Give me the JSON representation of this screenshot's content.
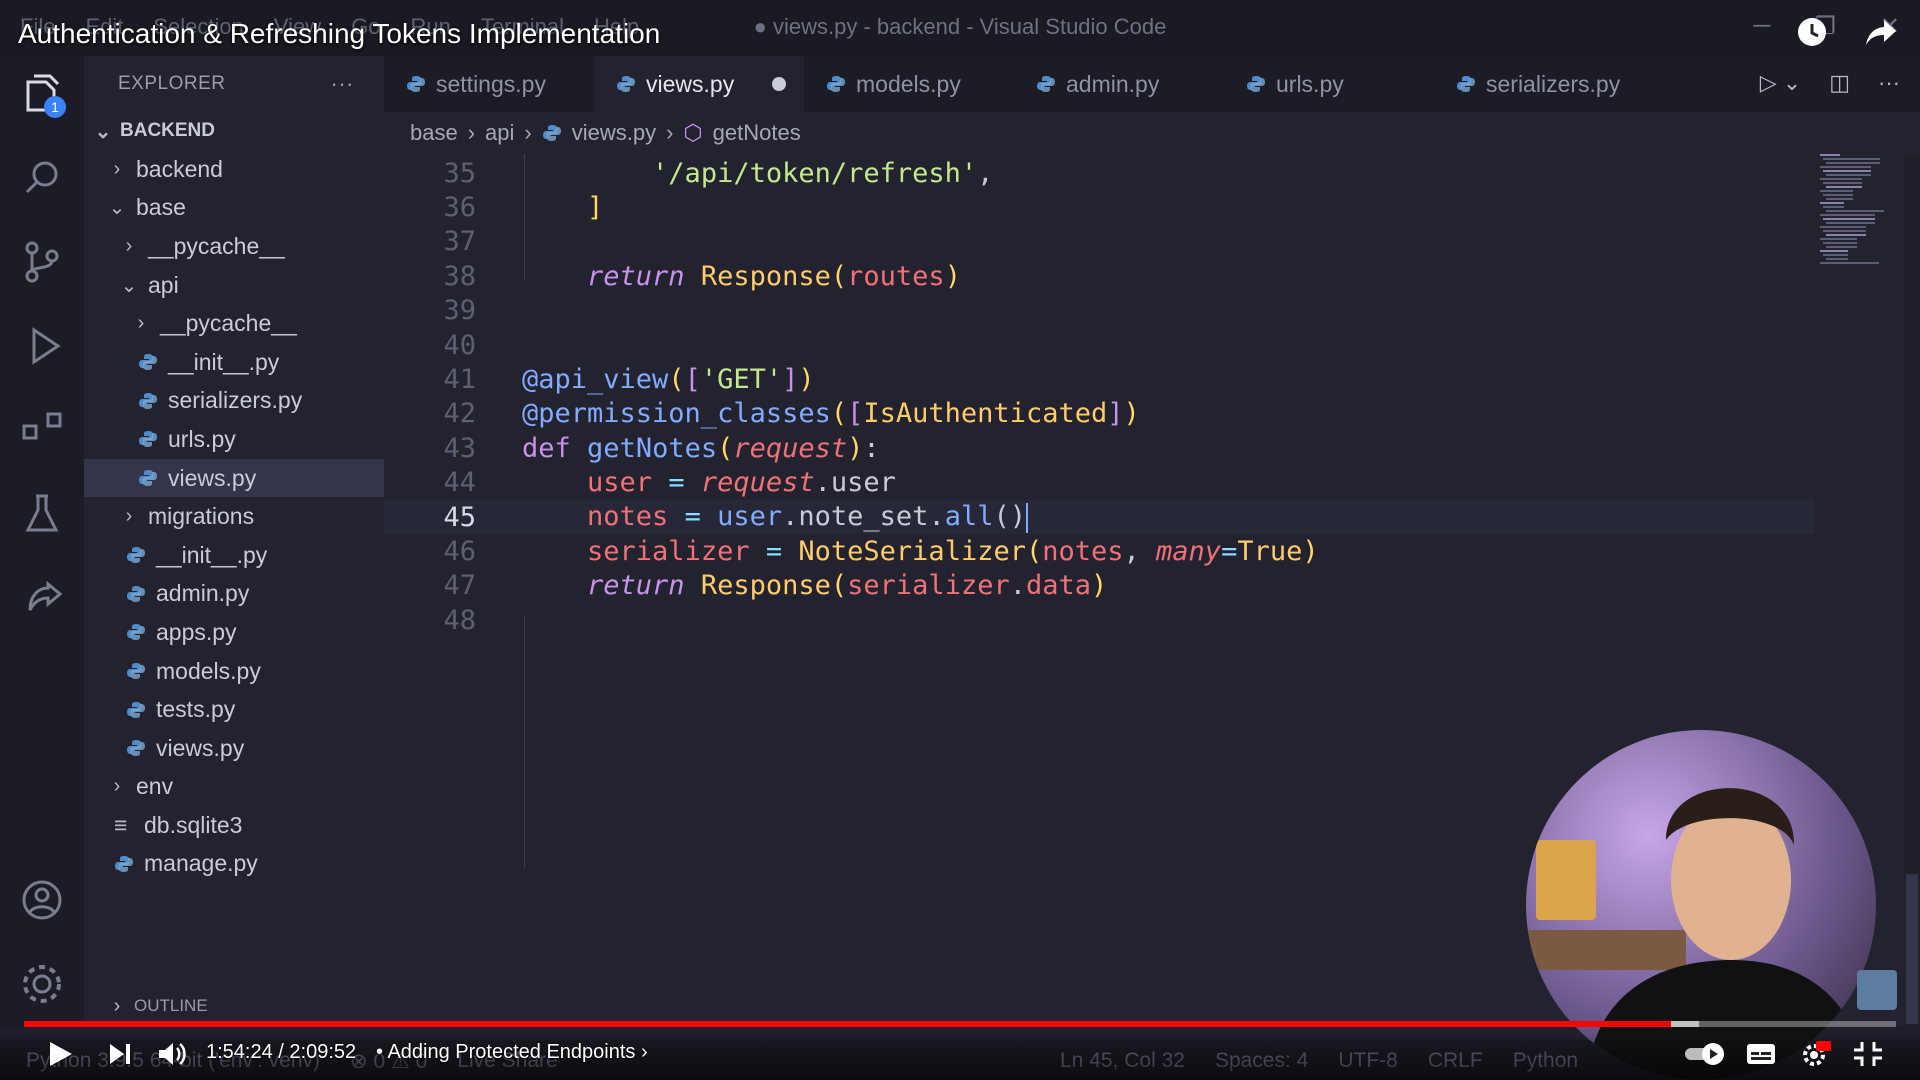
{
  "video": {
    "title": "Authentication & Refreshing Tokens Implementation",
    "time": "1:54:24 / 2:09:52",
    "chapter": "Adding Protected Endpoints",
    "chapter_sep": "•",
    "progress_fraction": 0.88
  },
  "window": {
    "menu": [
      "File",
      "Edit",
      "Selection",
      "View",
      "Go",
      "Run",
      "Terminal",
      "Help"
    ],
    "title": "● views.py - backend - Visual Studio Code"
  },
  "activity": {
    "explorer_badge": "1"
  },
  "sidebar": {
    "header": "EXPLORER",
    "more": "···",
    "root": "BACKEND",
    "items": [
      {
        "label": "backend",
        "type": "folder",
        "open": false,
        "depth": 1
      },
      {
        "label": "base",
        "type": "folder",
        "open": true,
        "depth": 1
      },
      {
        "label": "__pycache__",
        "type": "folder",
        "open": false,
        "depth": 2
      },
      {
        "label": "api",
        "type": "folder",
        "open": true,
        "depth": 2
      },
      {
        "label": "__pycache__",
        "type": "folder",
        "open": false,
        "depth": 3
      },
      {
        "label": "__init__.py",
        "type": "py",
        "depth": 3
      },
      {
        "label": "serializers.py",
        "type": "py",
        "depth": 3
      },
      {
        "label": "urls.py",
        "type": "py",
        "depth": 3
      },
      {
        "label": "views.py",
        "type": "py",
        "depth": 3,
        "selected": true
      },
      {
        "label": "migrations",
        "type": "folder",
        "open": false,
        "depth": 2
      },
      {
        "label": "__init__.py",
        "type": "py",
        "depth": 2
      },
      {
        "label": "admin.py",
        "type": "py",
        "depth": 2
      },
      {
        "label": "apps.py",
        "type": "py",
        "depth": 2
      },
      {
        "label": "models.py",
        "type": "py",
        "depth": 2
      },
      {
        "label": "tests.py",
        "type": "py",
        "depth": 2
      },
      {
        "label": "views.py",
        "type": "py",
        "depth": 2
      },
      {
        "label": "env",
        "type": "folder",
        "open": false,
        "depth": 1
      },
      {
        "label": "db.sqlite3",
        "type": "db",
        "depth": 1
      },
      {
        "label": "manage.py",
        "type": "py",
        "depth": 1
      }
    ],
    "outline": "OUTLINE"
  },
  "tabs": [
    {
      "label": "settings.py",
      "active": false
    },
    {
      "label": "views.py",
      "active": true,
      "modified": true
    },
    {
      "label": "models.py",
      "active": false
    },
    {
      "label": "admin.py",
      "active": false
    },
    {
      "label": "urls.py",
      "active": false
    },
    {
      "label": "serializers.py",
      "active": false
    }
  ],
  "breadcrumb": [
    "base",
    "api",
    "views.py",
    "getNotes"
  ],
  "editor": {
    "current_line": "45",
    "lines": [
      {
        "n": "35",
        "tokens": [
          [
            "pl",
            "        "
          ],
          [
            "s",
            "'/api/token/refresh'"
          ],
          [
            "pl",
            ","
          ]
        ]
      },
      {
        "n": "36",
        "tokens": [
          [
            "pl",
            "    "
          ],
          [
            "br",
            "]"
          ]
        ]
      },
      {
        "n": "37",
        "tokens": []
      },
      {
        "n": "38",
        "tokens": [
          [
            "pl",
            "    "
          ],
          [
            "k it",
            "return"
          ],
          [
            "pl",
            " "
          ],
          [
            "cls",
            "Response"
          ],
          [
            "br",
            "("
          ],
          [
            "v",
            "routes"
          ],
          [
            "br",
            ")"
          ]
        ]
      },
      {
        "n": "39",
        "tokens": []
      },
      {
        "n": "40",
        "tokens": []
      },
      {
        "n": "41",
        "tokens": [
          [
            "fn",
            "@api_view"
          ],
          [
            "br",
            "("
          ],
          [
            "k",
            "["
          ],
          [
            "s",
            "'GET'"
          ],
          [
            "k",
            "]"
          ],
          [
            "br",
            ")"
          ]
        ]
      },
      {
        "n": "42",
        "tokens": [
          [
            "fn",
            "@permission_classes"
          ],
          [
            "br",
            "("
          ],
          [
            "k",
            "["
          ],
          [
            "cls",
            "IsAuthenticated"
          ],
          [
            "k",
            "]"
          ],
          [
            "br",
            ")"
          ]
        ]
      },
      {
        "n": "43",
        "tokens": [
          [
            "k",
            "def"
          ],
          [
            "pl",
            " "
          ],
          [
            "fn",
            "getNotes"
          ],
          [
            "br",
            "("
          ],
          [
            "v it",
            "request"
          ],
          [
            "br",
            ")"
          ],
          [
            "pl",
            ":"
          ]
        ]
      },
      {
        "n": "44",
        "tokens": [
          [
            "pl",
            "    "
          ],
          [
            "v",
            "user"
          ],
          [
            "pl",
            " "
          ],
          [
            "op",
            "="
          ],
          [
            "pl",
            " "
          ],
          [
            "v it",
            "request"
          ],
          [
            "pl",
            ".user"
          ]
        ]
      },
      {
        "n": "45",
        "tokens": [
          [
            "pl",
            "    "
          ],
          [
            "v",
            "notes"
          ],
          [
            "pl",
            " "
          ],
          [
            "op",
            "="
          ],
          [
            "pl",
            " "
          ],
          [
            "fn",
            "user"
          ],
          [
            "pl",
            ".note_set."
          ],
          [
            "fn",
            "all"
          ],
          [
            "pl",
            "()"
          ]
        ]
      },
      {
        "n": "46",
        "tokens": [
          [
            "pl",
            "    "
          ],
          [
            "v",
            "serializer"
          ],
          [
            "pl",
            " "
          ],
          [
            "op",
            "="
          ],
          [
            "pl",
            " "
          ],
          [
            "cls",
            "NoteSerializer"
          ],
          [
            "br",
            "("
          ],
          [
            "v",
            "notes"
          ],
          [
            "pl",
            ", "
          ],
          [
            "v it",
            "many"
          ],
          [
            "op",
            "="
          ],
          [
            "cls",
            "True"
          ],
          [
            "br",
            ")"
          ]
        ]
      },
      {
        "n": "47",
        "tokens": [
          [
            "pl",
            "    "
          ],
          [
            "k it",
            "return"
          ],
          [
            "pl",
            " "
          ],
          [
            "cls",
            "Response"
          ],
          [
            "br",
            "("
          ],
          [
            "v",
            "serializer"
          ],
          [
            "pl",
            "."
          ],
          [
            "v",
            "data"
          ],
          [
            "br",
            ")"
          ]
        ]
      },
      {
        "n": "48",
        "tokens": []
      }
    ]
  },
  "statusbar": {
    "left": [
      "Python 3.9.5 64-bit ('env': venv)",
      "⊗ 0 ⚠ 0",
      "Live Share"
    ],
    "right": [
      "Ln 45, Col 32",
      "Spaces: 4",
      "UTF-8",
      "CRLF",
      "Python"
    ]
  },
  "colors": {
    "accent": "#ff0000",
    "editor_bg": "#22232f",
    "sidebar_bg": "#22232f"
  }
}
